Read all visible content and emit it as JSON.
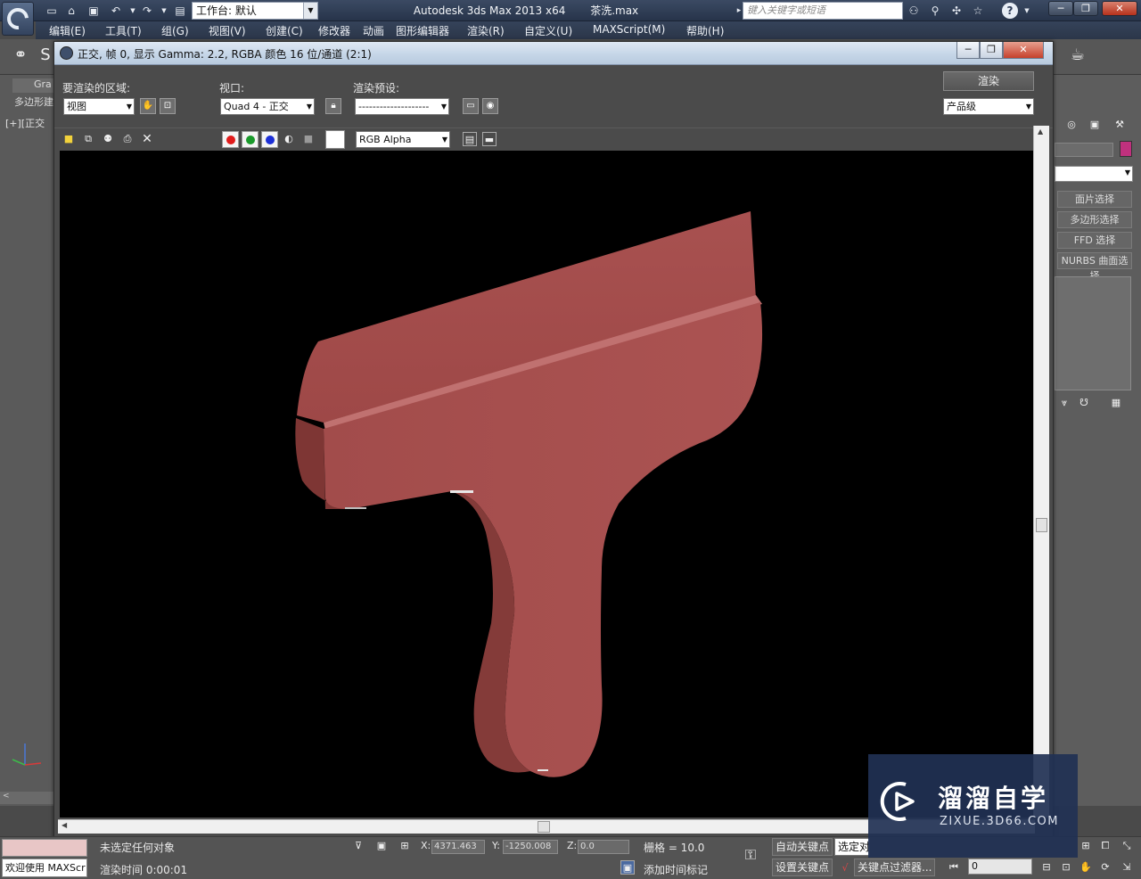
{
  "app": {
    "title": "Autodesk 3ds Max  2013 x64",
    "file": "茶洗.max",
    "workspace": "工作台: 默认",
    "search_placeholder": "键入关键字或短语"
  },
  "menu": [
    "编辑(E)",
    "工具(T)",
    "组(G)",
    "视图(V)",
    "创建(C)",
    "修改器",
    "动画",
    "图形编辑器",
    "渲染(R)",
    "自定义(U)",
    "MAXScript(M)",
    "帮助(H)"
  ],
  "workspace_bg": {
    "ribbon_label": "Gra",
    "ribbon_sublabel": "多边形建",
    "viewport_label": "[+][正交",
    "modifier_buttons": [
      "面片选择",
      "多边形选择",
      "FFD 选择",
      "NURBS 曲面选择"
    ],
    "left_scroll": "<"
  },
  "render_window": {
    "title": "正交, 帧 0, 显示 Gamma: 2.2, RGBA 颜色 16 位/通道 (2:1)",
    "area_label": "要渲染的区域:",
    "area_value": "视图",
    "viewport_label": "视口:",
    "viewport_value": "Quad 4 - 正交",
    "preset_label": "渲染预设:",
    "preset_value": "--------------------",
    "render_button": "渲染",
    "quality_value": "产品级",
    "channel_value": "RGB Alpha"
  },
  "statusbar": {
    "selection": "未选定任何对象",
    "render_time": "渲染时间  0:00:01",
    "welcome": "欢迎使用 MAXScr",
    "x_label": "X:",
    "x_value": "4371.463",
    "y_label": "Y:",
    "y_value": "-1250.008",
    "z_label": "Z:",
    "z_value": "0.0",
    "grid": "栅格 = 10.0",
    "add_time_tag": "添加时间标记",
    "auto_key": "自动关键点",
    "selected_obj": "选定对",
    "set_key": "设置关键点",
    "key_filters": "关键点过滤器...",
    "frame": "0"
  },
  "watermark": {
    "title": "溜溜自学",
    "url": "ZIXUE.3D66.COM"
  },
  "colors": {
    "object": "#a8504f",
    "accent_swatch": "#c0317e"
  }
}
